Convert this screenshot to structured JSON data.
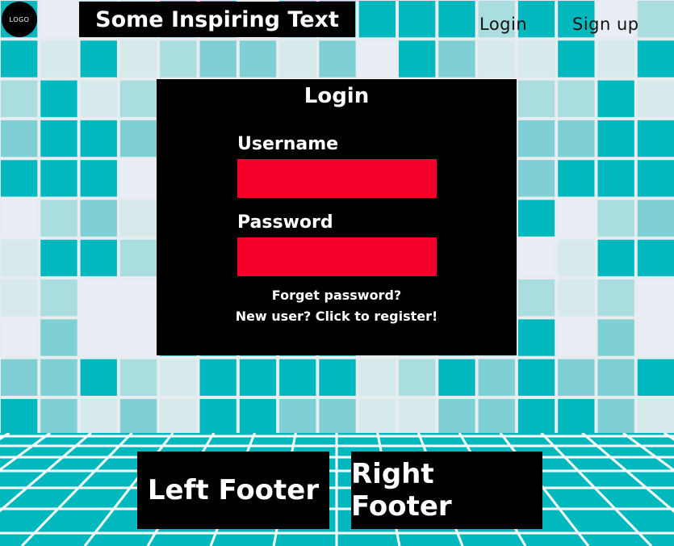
{
  "colors": {
    "tile_palette": [
      "#00b8be",
      "#a9dde0",
      "#d6e9eb",
      "#7ed0d4",
      "#e9eef6"
    ],
    "floor_base": "#00b8be",
    "floor_lines": "#ffffff",
    "panel_bg": "#000000",
    "input_bg": "#f4002a"
  },
  "header": {
    "logo_text": "LOGO",
    "tagline": "Some Inspiring Text",
    "nav": {
      "login": "Login",
      "signup": "Sign up"
    }
  },
  "login_panel": {
    "title": "Login",
    "username_label": "Username",
    "username_value": "",
    "password_label": "Password",
    "password_value": "",
    "forgot_link": "Forget password?",
    "register_link": "New user? Click to register!"
  },
  "footer": {
    "left": "Left Footer",
    "right": "Right Footer"
  }
}
